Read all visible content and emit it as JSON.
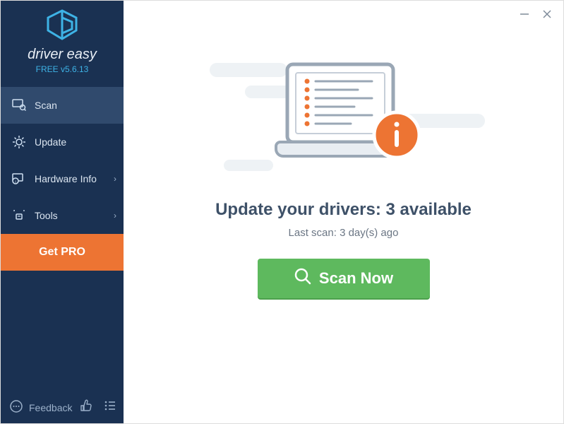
{
  "brand": {
    "name": "driver easy",
    "version": "FREE v5.6.13"
  },
  "sidebar": {
    "items": [
      {
        "label": "Scan"
      },
      {
        "label": "Update"
      },
      {
        "label": "Hardware Info"
      },
      {
        "label": "Tools"
      }
    ],
    "get_pro": "Get PRO",
    "feedback": "Feedback"
  },
  "main": {
    "headline": "Update your drivers: 3 available",
    "subhead": "Last scan: 3 day(s) ago",
    "scan_button": "Scan Now"
  }
}
